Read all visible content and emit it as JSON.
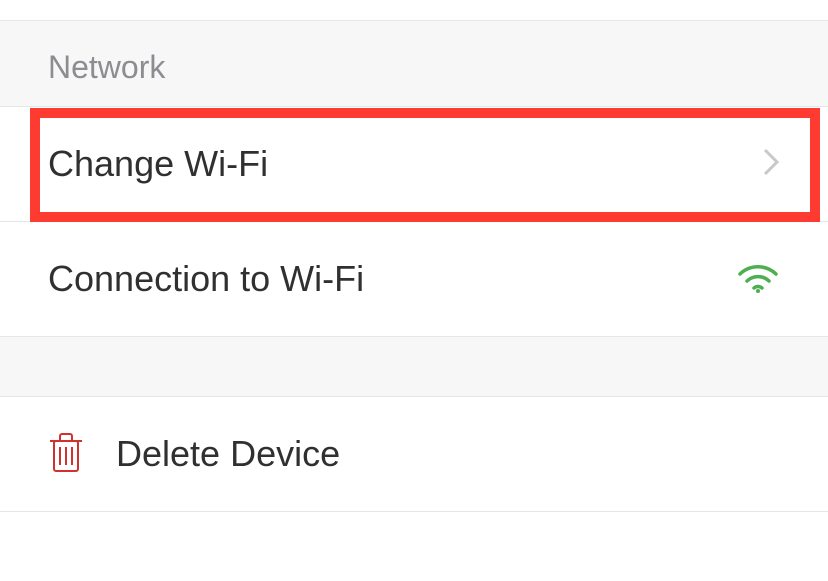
{
  "section": {
    "header": "Network"
  },
  "rows": {
    "change_wifi": "Change Wi-Fi",
    "connection_to_wifi": "Connection to Wi-Fi",
    "delete_device": "Delete Device"
  }
}
